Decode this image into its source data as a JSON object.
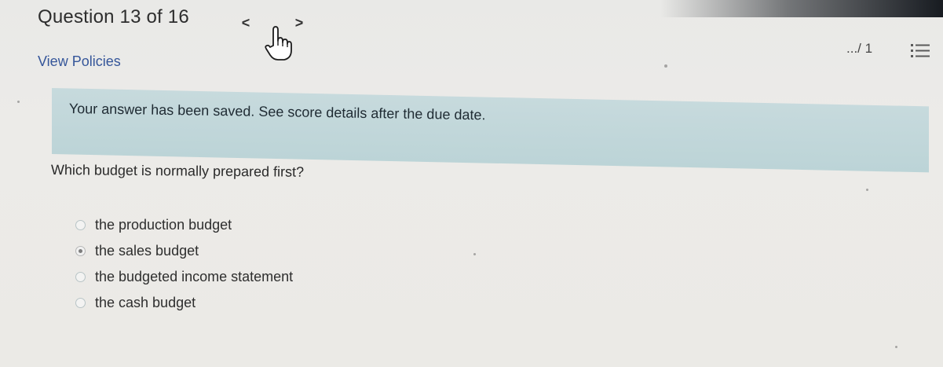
{
  "header": {
    "question_counter": "Question 13 of 16",
    "prev_label": "<",
    "next_label": ">",
    "view_policies_label": "View Policies",
    "score": ".../ 1"
  },
  "banner": {
    "message": "Your answer has been saved. See score details after the due date."
  },
  "question": {
    "prompt": "Which budget is normally prepared first?",
    "options": [
      {
        "label": "the production budget",
        "selected": false
      },
      {
        "label": "the sales budget",
        "selected": true
      },
      {
        "label": "the budgeted income statement",
        "selected": false
      },
      {
        "label": "the cash budget",
        "selected": false
      }
    ]
  },
  "icons": {
    "prev": "chevron-left-icon",
    "next": "chevron-right-icon",
    "cursor": "hand-cursor-icon",
    "list": "question-list-icon"
  },
  "colors": {
    "banner_bg": "#c3d8db",
    "link": "#35569a",
    "page_bg": "#ebeae7"
  }
}
